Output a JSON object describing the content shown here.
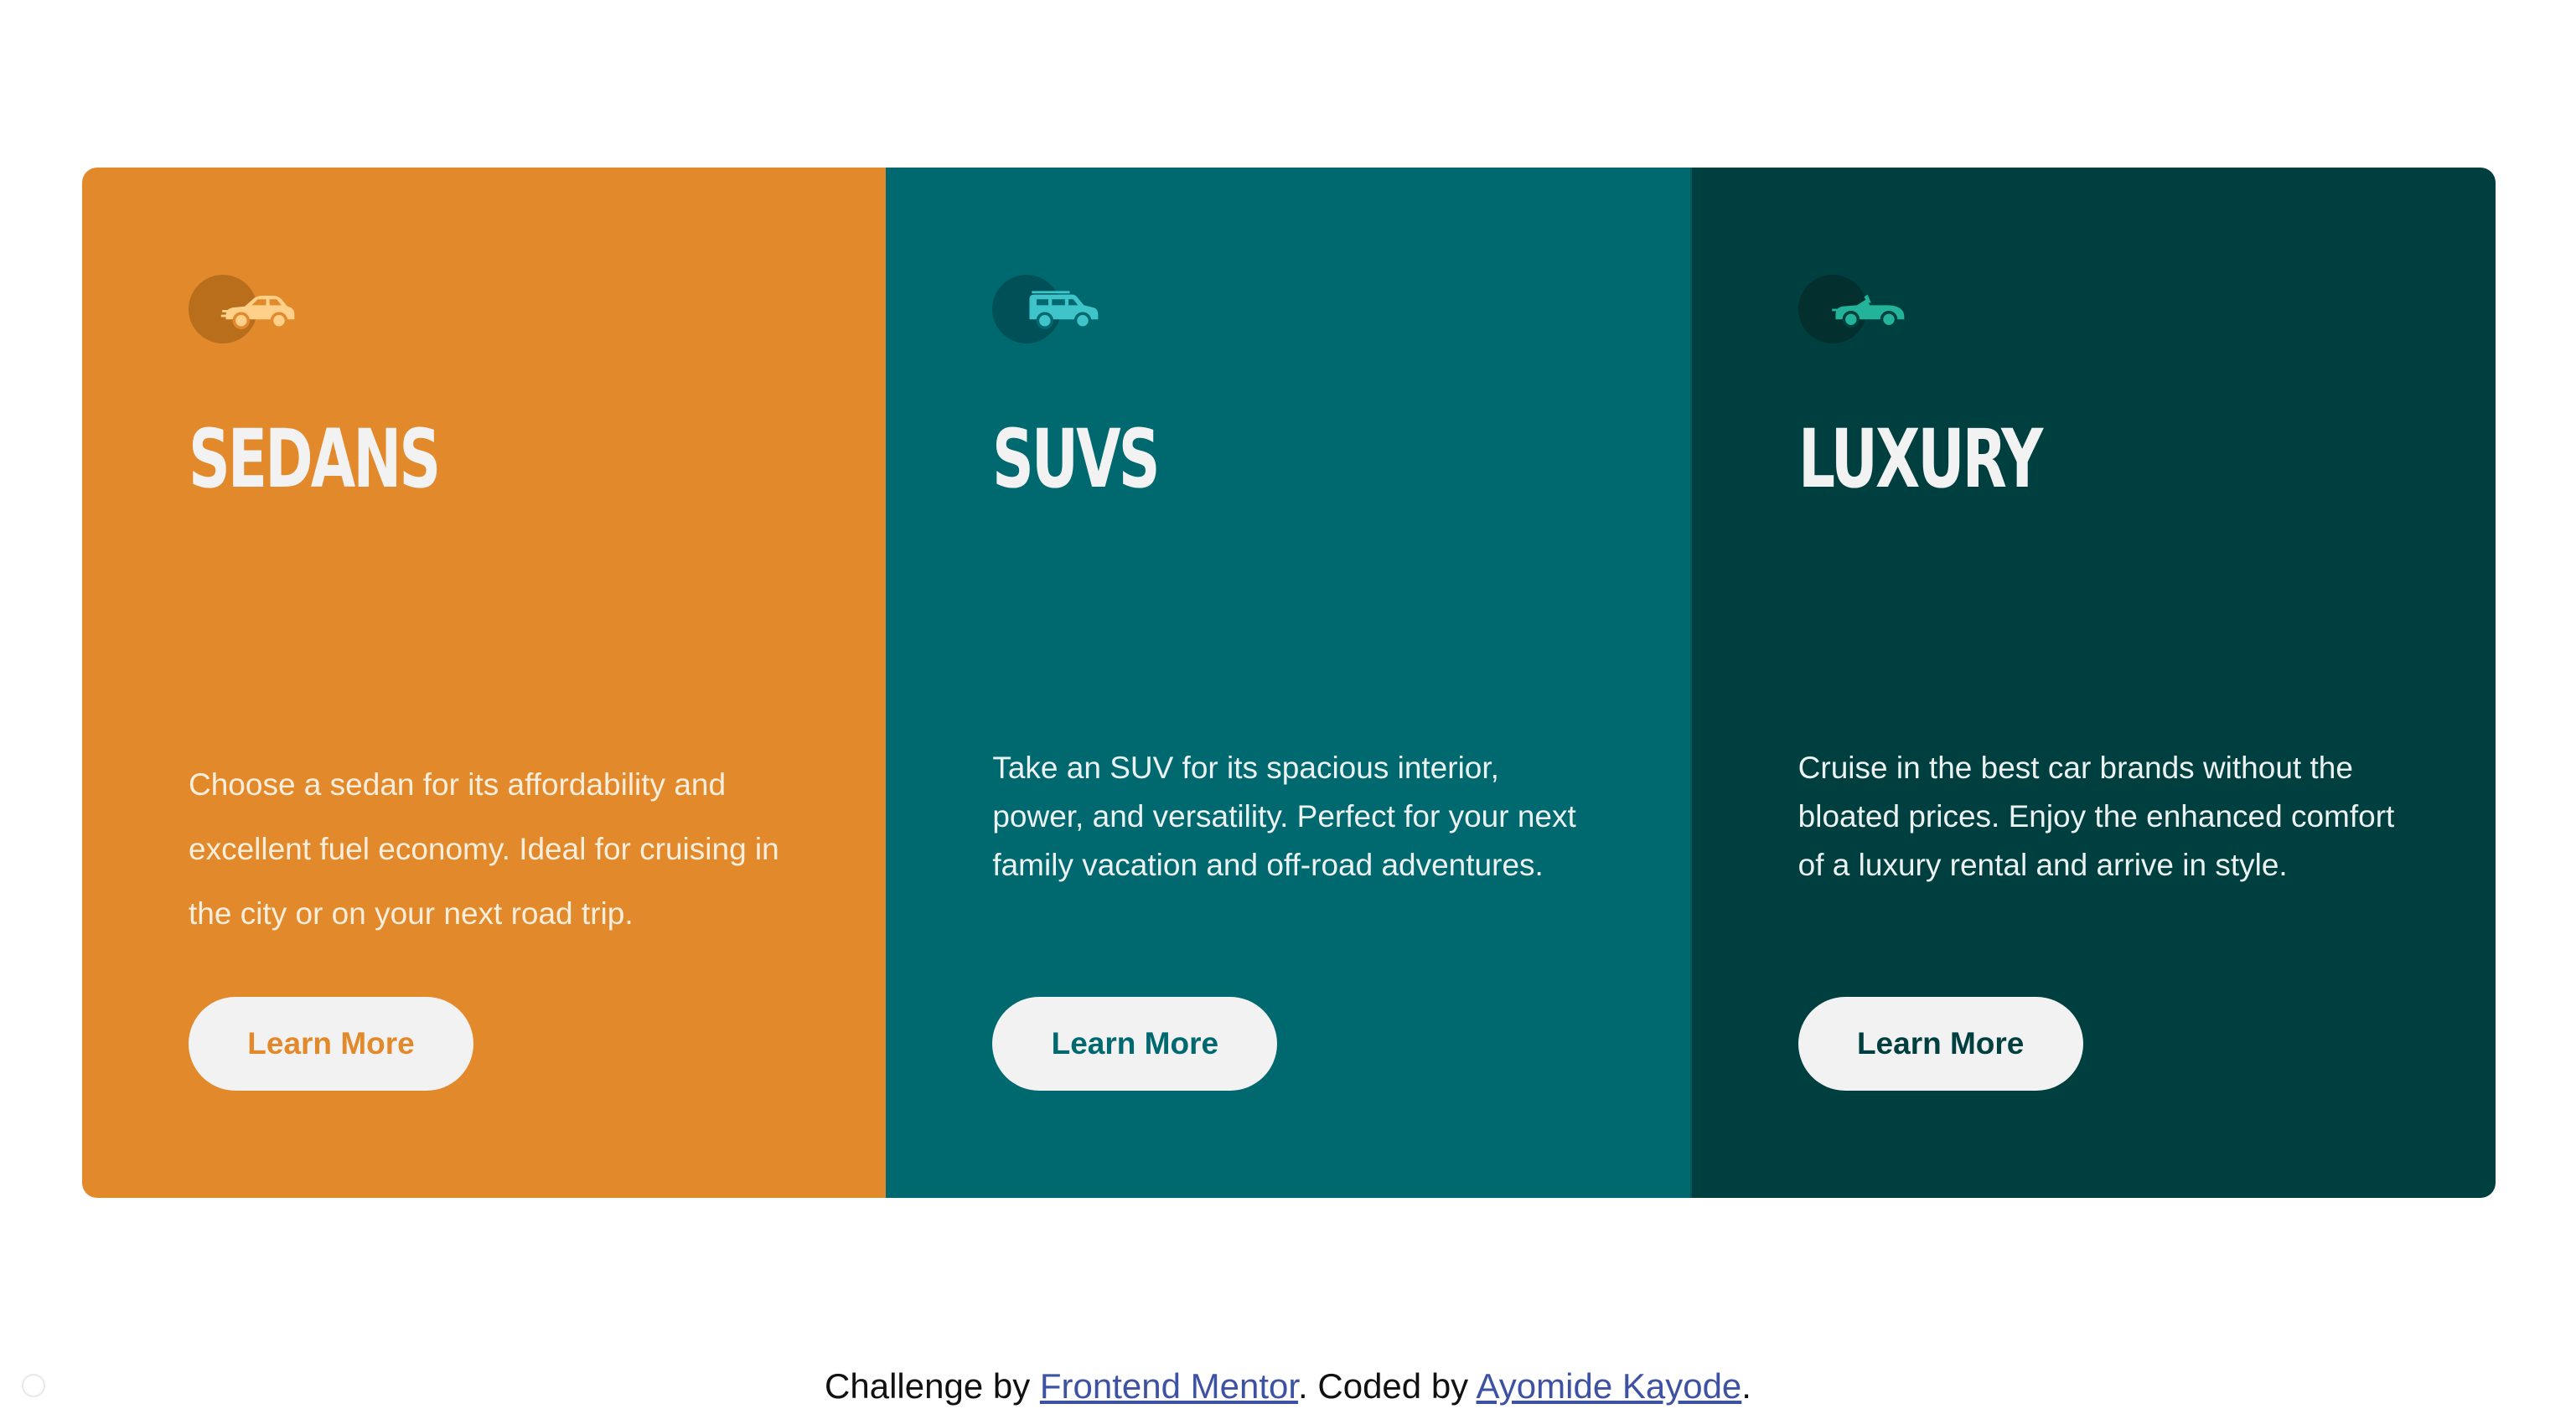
{
  "colors": {
    "sedans_bg": "#e28a2b",
    "suvs_bg": "#006970",
    "luxury_bg": "#003f3f",
    "card_text": "#f2f2f2",
    "button_bg": "#f2f2f2",
    "link": "#3e52a3"
  },
  "cards": [
    {
      "icon": "sedan-car-icon",
      "title": "SEDANS",
      "description": "Choose a sedan for its affordability and excellent fuel economy. Ideal for cruising in the city or on your next road trip.",
      "button_label": "Learn More"
    },
    {
      "icon": "suv-car-icon",
      "title": "SUVS",
      "description": "Take an SUV for its spacious interior, power, and versatility. Perfect for your next family vacation and off-road adventures.",
      "button_label": "Learn More"
    },
    {
      "icon": "luxury-car-icon",
      "title": "LUXURY",
      "description": "Cruise in the best car brands without the bloated prices. Enjoy the enhanced comfort of a luxury rental and arrive in style.",
      "button_label": "Learn More"
    }
  ],
  "footer": {
    "prefix": "Challenge by ",
    "challenge_link": "Frontend Mentor",
    "middle": ". Coded by ",
    "author_link": "Ayomide Kayode",
    "suffix": "."
  }
}
